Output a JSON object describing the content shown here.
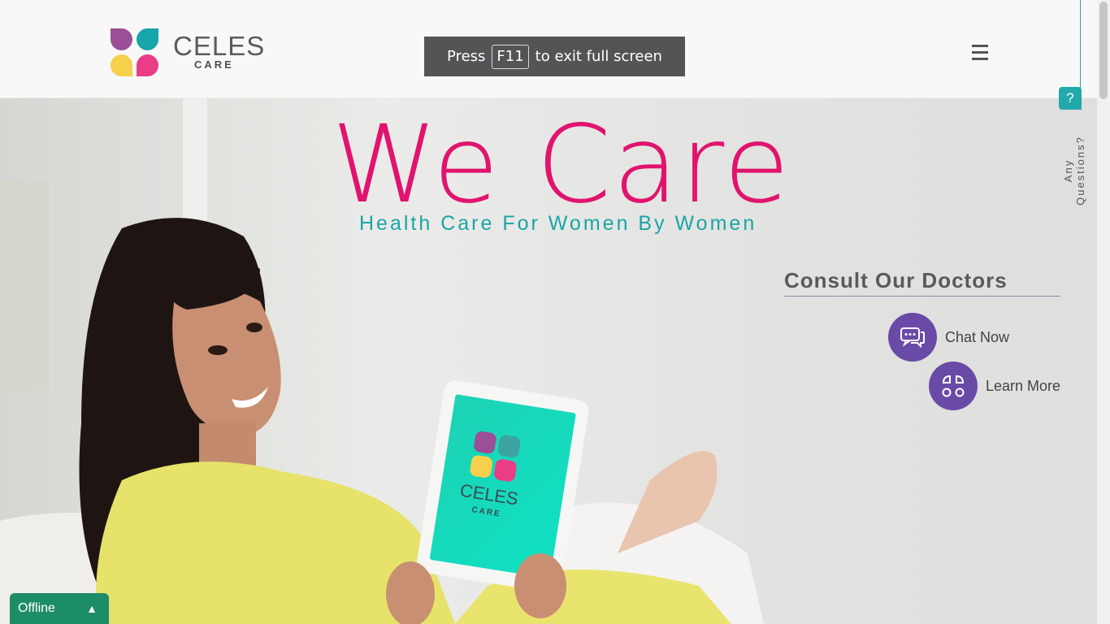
{
  "brand": {
    "name": "CELES",
    "sub": "CARE",
    "colors": {
      "purple": "#9b4f96",
      "teal": "#17a6a9",
      "yellow": "#f6d04d",
      "pink": "#ea3d86"
    }
  },
  "fullscreen_toast": {
    "prefix": "Press",
    "key": "F11",
    "suffix": "to exit full screen"
  },
  "nav": {
    "menu_icon": "hamburger-icon"
  },
  "hero": {
    "title": "We Care",
    "tagline": "Health Care For Women By Women",
    "tablet_brand": "CELES",
    "tablet_sub": "CARE"
  },
  "consult": {
    "heading": "Consult Our Doctors",
    "actions": [
      {
        "label": "Chat Now",
        "icon": "chat-icon"
      },
      {
        "label": "Learn More",
        "icon": "apps-icon"
      }
    ]
  },
  "side_widget": {
    "icon_text": "?",
    "label": "Any Questions?"
  },
  "chat_status": {
    "label": "Offline",
    "icon": "chevron-up-icon"
  },
  "colors": {
    "accent_pink": "#e0146e",
    "accent_teal": "#1aa5a6",
    "button_purple": "#6a4aa7",
    "offline_green": "#1d8d68"
  }
}
